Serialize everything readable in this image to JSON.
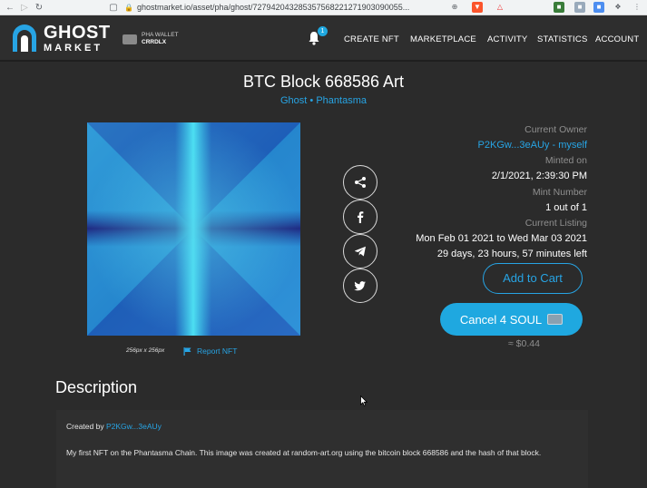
{
  "browser": {
    "url": "ghostmarket.io/asset/pha/ghost/727942043285357568221271903090055...",
    "colors": {
      "chrome": "#f1f3f4"
    }
  },
  "header": {
    "logo_line1": "GHOST",
    "logo_line2": "MARKET",
    "wallet_label": "PHA WALLET",
    "wallet_name": "CRRDLX",
    "notification_count": "1",
    "menu": [
      "CREATE NFT",
      "MARKETPLACE",
      "ACTIVITY",
      "STATISTICS",
      "ACCOUNT"
    ]
  },
  "nft": {
    "title": "BTC Block 668586 Art",
    "collection": "Ghost",
    "chain": "Phantasma",
    "image_size": "256px x 256px",
    "report_label": "Report NFT"
  },
  "info": {
    "owner_label": "Current Owner",
    "owner_value": "P2KGw...3eAUy",
    "owner_self": "myself",
    "minted_label": "Minted on",
    "minted_value": "2/1/2021, 2:39:30 PM",
    "mint_number_label": "Mint Number",
    "mint_number_value": "1 out of 1",
    "listing_label": "Current Listing",
    "listing_range": "Mon Feb 01 2021 to Wed Mar 03 2021",
    "listing_remaining": "29 days, 23 hours, 57 minutes left",
    "add_to_cart": "Add to Cart",
    "cancel_label": "Cancel 4 SOUL",
    "usd_value": "≈ $0.44"
  },
  "description": {
    "heading": "Description",
    "created_by_label": "Created by",
    "created_by_value": "P2KGw...3eAUy",
    "text": "My first NFT on the Phantasma Chain. This image was created at random-art.org using the bitcoin block 668586 and the hash of that block."
  },
  "icons": [
    "share-icon",
    "facebook-icon",
    "telegram-icon",
    "twitter-icon",
    "bell-icon",
    "flag-icon"
  ],
  "colors": {
    "accent": "#27a4e4",
    "background": "#2b2b2b",
    "button": "#1fa8e0"
  }
}
